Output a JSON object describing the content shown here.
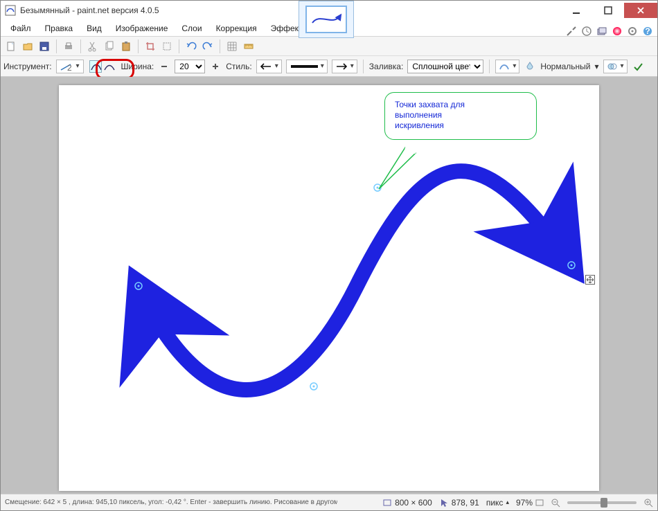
{
  "titlebar": {
    "title": "Безымянный - paint.net версия 4.0.5"
  },
  "menu": {
    "file": "Файл",
    "edit": "Правка",
    "view": "Вид",
    "image": "Изображение",
    "layers": "Слои",
    "adjustments": "Коррекция",
    "effects": "Эффекты"
  },
  "optionsbar": {
    "tool_label": "Инструмент:",
    "width_label": "Ширина:",
    "width_value": "20",
    "style_label": "Стиль:",
    "fill_label": "Заливка:",
    "fill_value": "Сплошной цвет",
    "blend_label": "Нормальный"
  },
  "callout": {
    "line1": "Точки захвата для",
    "line2": "выполнения",
    "line3": "искривления"
  },
  "statusbar": {
    "hint": "Смещение: 642 × 5 , длина: 945,10 пиксель, угол: -0,42 °. Enter - завершить линию. Рисование в другом месте создаст новую.",
    "canvas_size": "800 × 600",
    "cursor_pos": "878, 91",
    "units": "пикс",
    "zoom": "97%"
  }
}
